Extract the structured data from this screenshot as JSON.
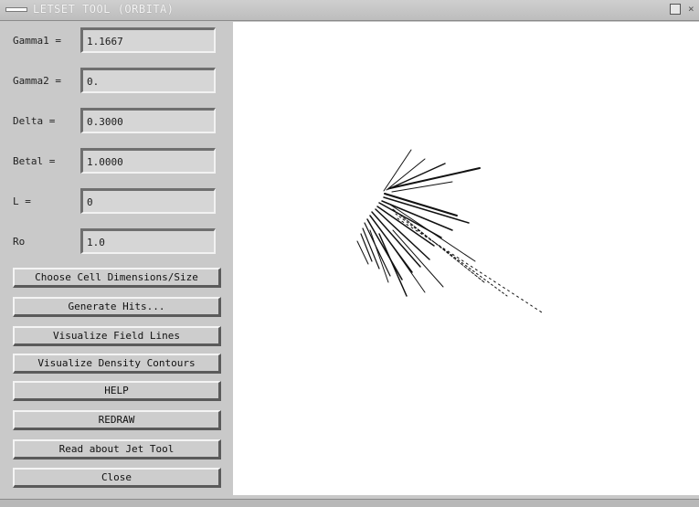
{
  "window": {
    "title": "LETSET TOOL (ORBITA)",
    "menu_icon": "window-menu-icon",
    "maximize_icon": "maximize-icon",
    "close_icon": "close-icon",
    "close_glyph": "×"
  },
  "fields": [
    {
      "label": "Gamma1 =",
      "value": "1.1667"
    },
    {
      "label": "Gamma2 =",
      "value": "0."
    },
    {
      "label": "Delta  =",
      "value": "0.3000"
    },
    {
      "label": "Betal  =",
      "value": "1.0000"
    },
    {
      "label": "L      =",
      "value": "0"
    },
    {
      "label": "Ro",
      "value": "1.0"
    }
  ],
  "buttons": [
    {
      "label": "Choose Cell Dimensions/Size"
    },
    {
      "label": "Generate Hits..."
    },
    {
      "label": "Visualize Field Lines"
    },
    {
      "label": "Visualize Density Contours"
    },
    {
      "label": "HELP"
    },
    {
      "label": "REDRAW"
    },
    {
      "label": "Read about Jet Tool"
    },
    {
      "label": "Close"
    }
  ],
  "colors": {
    "background": "#c9c9c9",
    "canvas": "#ffffff",
    "trace": "#111111"
  }
}
